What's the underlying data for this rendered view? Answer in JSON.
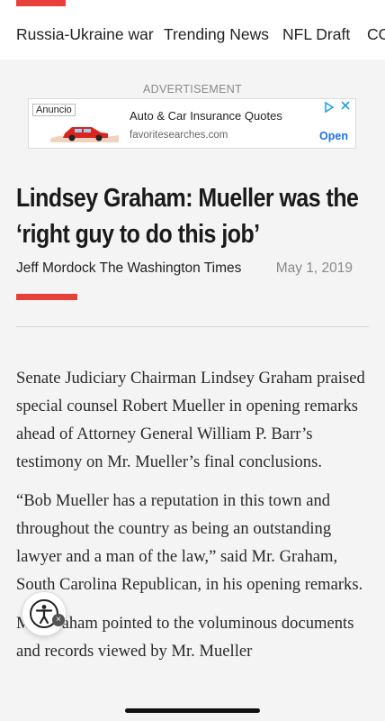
{
  "nav": {
    "items": [
      "Russia-Ukraine war",
      "Trending News",
      "NFL Draft",
      "CO"
    ]
  },
  "ad": {
    "label": "ADVERTISEMENT",
    "tag": "Anuncio",
    "title": "Auto & Car Insurance Quotes",
    "url": "favoritesearches.com",
    "cta": "Open"
  },
  "article": {
    "headline": "Lindsey Graham: Mueller was the ‘right guy to do this job’",
    "byline": "Jeff Mordock The Washington Times",
    "date": "May 1, 2019",
    "paragraphs": [
      "Senate Judiciary Chairman Lindsey Graham praised special counsel Robert Mueller in opening remarks ahead of Attorney General William P. Barr’s testimony on Mr. Mueller’s final conclusions.",
      "“Bob Mueller has a reputation in this town and throughout the country as being an outstanding lawyer and a man of the law,” said Mr. Graham, South Carolina Republican, in his opening remarks.",
      "Mr. Graham pointed to the voluminous documents and records viewed by Mr. Mueller"
    ]
  },
  "colors": {
    "accent": "#e8413c",
    "ad_link": "#1a73e8"
  },
  "icons": {
    "accessibility": "accessibility-icon",
    "close": "close-icon",
    "adchoices": "adchoices-icon"
  }
}
